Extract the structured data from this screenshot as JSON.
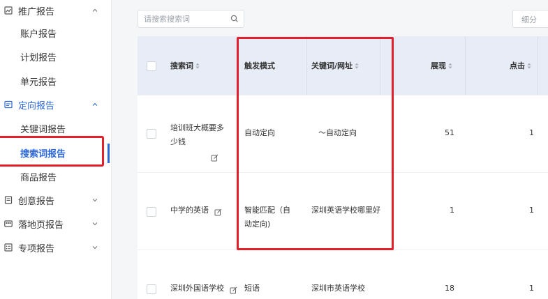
{
  "sidebar": {
    "groups": [
      {
        "label": "推广报告",
        "expanded": true,
        "icon": "chart-icon"
      },
      {
        "label": "定向报告",
        "expanded": true,
        "icon": "target-report-icon"
      },
      {
        "label": "创意报告",
        "expanded": false,
        "icon": "creative-icon"
      },
      {
        "label": "落地页报告",
        "expanded": false,
        "icon": "landing-page-icon"
      },
      {
        "label": "专项报告",
        "expanded": false,
        "icon": "special-report-icon"
      }
    ],
    "promo_items": [
      "账户报告",
      "计划报告",
      "单元报告"
    ],
    "targeting_items": [
      "关键词报告",
      "搜索词报告",
      "商品报告"
    ],
    "selected": "搜索词报告"
  },
  "search": {
    "placeholder": "请搜索搜索词"
  },
  "granularity": {
    "label": "细分"
  },
  "table": {
    "columns": [
      "搜索词",
      "触发模式",
      "关键词/网址",
      "展现",
      "点击"
    ],
    "rows": [
      {
        "term_line1": "培训班大概要多",
        "term_line2": "少钱",
        "mode_line1": "自动定向",
        "mode_line2": "",
        "keyword": "～自动定向",
        "impressions": "51",
        "clicks": "1"
      },
      {
        "term_line1": "中学的英语",
        "term_line2": "",
        "mode_line1": "智能匹配（自",
        "mode_line2": "动定向)",
        "keyword": "深圳英语学校哪里好",
        "impressions": "1",
        "clicks": "1"
      },
      {
        "term_line1": "深圳外国语学校",
        "term_line2": "",
        "mode_line1": "短语",
        "mode_line2": "",
        "keyword": "深圳市英语学校",
        "impressions": "18",
        "clicks": "1"
      }
    ]
  },
  "colors": {
    "accent": "#2b67d8",
    "highlight_box": "#e0202a",
    "header_bg": "#e7ecf6"
  }
}
